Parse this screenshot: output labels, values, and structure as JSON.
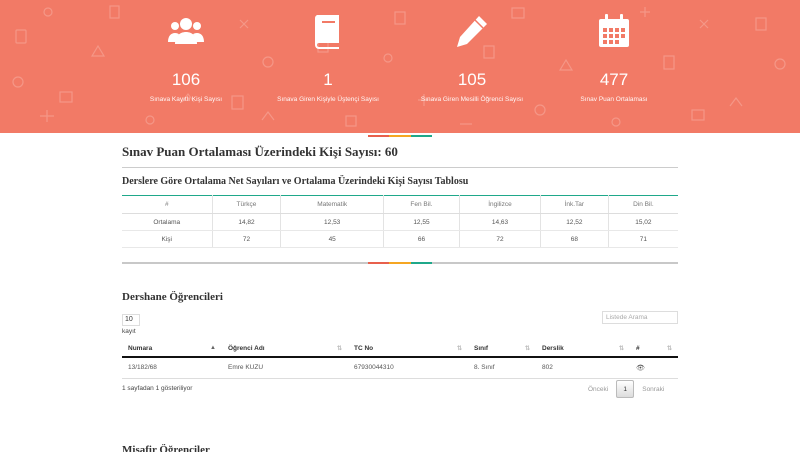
{
  "stats": [
    {
      "icon": "users-icon",
      "value": "106",
      "label": "Sınava Kayıtlı Kişi Sayısı"
    },
    {
      "icon": "book-icon",
      "value": "1",
      "label": "Sınava Giren Kişiyle Üştençi Sayısı"
    },
    {
      "icon": "pencil-icon",
      "value": "105",
      "label": "Sınava Giren Mesilli Öğrenci Sayısı"
    },
    {
      "icon": "calendar-icon",
      "value": "477",
      "label": "Sınav Puan Ortalaması"
    }
  ],
  "score_heading": "Sınav Puan Ortalaması Üzerindeki Kişi Sayısı: 60",
  "table_heading": "Derslere Göre Ortalama Net Sayıları ve Ortalama Üzerindeki Kişi Sayısı Tablosu",
  "stats_table": {
    "headers": [
      "#",
      "Türkçe",
      "Matematik",
      "Fen Bil.",
      "İngilizce",
      "İnk.Tar",
      "Din Bil."
    ],
    "rows": [
      [
        "Ortalama",
        "14,82",
        "12,53",
        "12,55",
        "14,63",
        "12,52",
        "15,02"
      ],
      [
        "Kişi",
        "72",
        "45",
        "66",
        "72",
        "68",
        "71"
      ]
    ]
  },
  "students_heading": "Dershane Öğrencileri",
  "length_value": "10",
  "length_label": "kayıt",
  "search_placeholder": "Listede Arama",
  "students_table": {
    "headers": [
      "Numara",
      "Öğrenci Adı",
      "TC No",
      "Sınıf",
      "Derslik",
      "#"
    ],
    "rows": [
      [
        "13/182/68",
        "Emre KUZU",
        "67930044310",
        "8. Sınıf",
        "802",
        "👁"
      ]
    ]
  },
  "info_text": "1 sayfadan 1 gösteriliyor",
  "pager": {
    "prev": "Önceki",
    "current": "1",
    "next": "Sonraki"
  },
  "next_heading": "Misafir Öğrenciler",
  "colors": {
    "banner": "#f27a66",
    "accent_teal": "#1fa88a",
    "accent_orange": "#f5a623",
    "accent_red": "#e8604c"
  }
}
